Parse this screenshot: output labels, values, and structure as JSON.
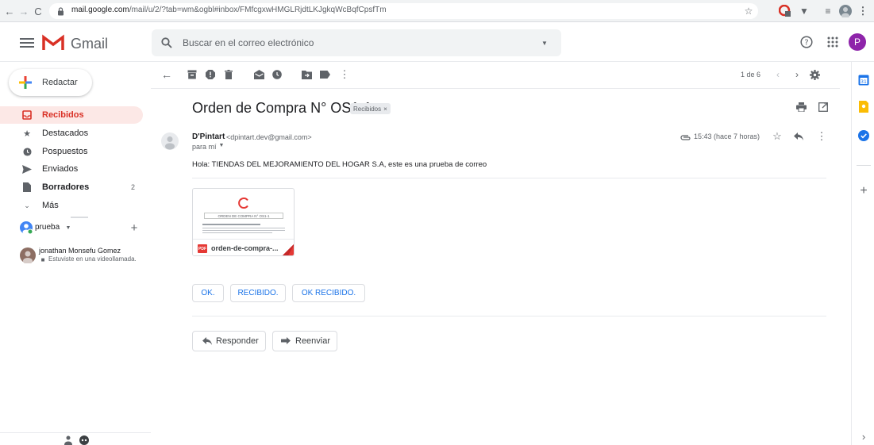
{
  "browser": {
    "url_domain": "mail.google.com",
    "url_path": "/mail/u/2/?tab=wm&ogbl#inbox/FMfcgxwHMGLRjdtLKJgkqWcBqfCpsfTm"
  },
  "header": {
    "app_name": "Gmail",
    "search_placeholder": "Buscar en el correo electrónico",
    "avatar_letter": "P"
  },
  "compose_label": "Redactar",
  "sidebar": {
    "items": [
      {
        "label": "Recibidos",
        "count": ""
      },
      {
        "label": "Destacados",
        "count": ""
      },
      {
        "label": "Pospuestos",
        "count": ""
      },
      {
        "label": "Enviados",
        "count": ""
      },
      {
        "label": "Borradores",
        "count": "2"
      },
      {
        "label": "Más",
        "count": ""
      }
    ],
    "hangouts_user": "prueba",
    "contact_name": "jonathan Monsefu Gomez",
    "contact_status": "Estuviste en una videollamada."
  },
  "toolbar": {
    "pager": "1 de 6"
  },
  "email": {
    "subject": "Orden de Compra N° OS1-1",
    "label_chip": "Recibidos",
    "sender_name": "D'Pintart",
    "sender_email": "<dpintart.dev@gmail.com>",
    "to": "para mí",
    "time": "15:43 (hace 7 horas)",
    "body": "Hola: TIENDAS DEL MEJORAMIENTO DEL HOGAR S.A, este es una prueba de correo",
    "attachment": {
      "filename": "orden-de-compra-...",
      "file_type": "PDF",
      "preview_title": "ORDEN DE COMPRA N° OS1-1"
    }
  },
  "smart_replies": [
    "OK.",
    "RECIBIDO.",
    "OK RECIBIDO."
  ],
  "actions": {
    "reply": "Responder",
    "forward": "Reenviar"
  },
  "colors": {
    "gmail_red": "#d93025",
    "link_blue": "#1a73e8",
    "avatar_purple": "#8e24aa",
    "inbox_highlight": "#fce8e6"
  }
}
